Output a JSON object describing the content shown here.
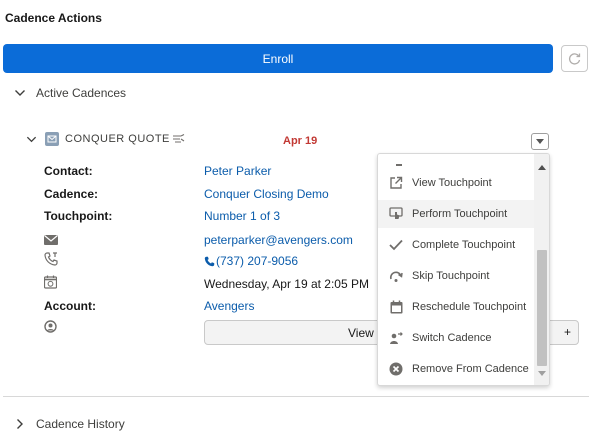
{
  "header": {
    "title": "Cadence Actions",
    "enroll_label": "Enroll"
  },
  "sections": {
    "active_label": "Active Cadences",
    "history_label": "Cadence History"
  },
  "cadence": {
    "name": "CONQUER QUOTE",
    "date": "Apr 19",
    "fields": {
      "contact_label": "Contact:",
      "contact_value": "Peter Parker",
      "cadence_label": "Cadence:",
      "cadence_value": "Conquer Closing Demo",
      "touchpoint_label": "Touchpoint:",
      "touchpoint_value": "Number 1 of 3",
      "email_value": "peterparker@avengers.com",
      "phone_value": "(737) 207-9056",
      "datetime_value": "Wednesday, Apr 19 at 2:05 PM",
      "account_label": "Account:",
      "account_value": "Avengers"
    },
    "view_button_label": "View",
    "plus_label": "+"
  },
  "menu": {
    "items": [
      {
        "label": "View Touchpoint",
        "icon": "external-link-icon"
      },
      {
        "label": "Perform Touchpoint",
        "icon": "touch-icon"
      },
      {
        "label": "Complete Touchpoint",
        "icon": "check-icon"
      },
      {
        "label": "Skip Touchpoint",
        "icon": "skip-icon"
      },
      {
        "label": "Reschedule Touchpoint",
        "icon": "calendar-icon"
      },
      {
        "label": "Switch Cadence",
        "icon": "switch-icon"
      },
      {
        "label": "Remove From Cadence",
        "icon": "remove-icon"
      }
    ],
    "hovered_index": 1
  },
  "colors": {
    "brand": "#0b6cd8",
    "link": "#0b5cab",
    "date": "#c23934",
    "icon_gray": "#706e6b"
  }
}
